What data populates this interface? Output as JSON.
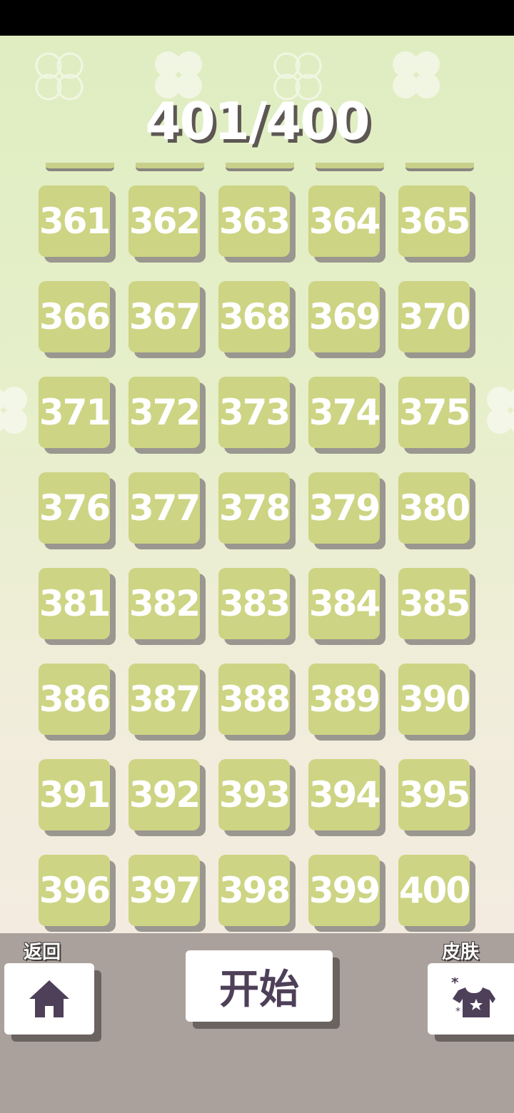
{
  "header": {
    "progress": "401/400"
  },
  "levels": [
    "361",
    "362",
    "363",
    "364",
    "365",
    "366",
    "367",
    "368",
    "369",
    "370",
    "371",
    "372",
    "373",
    "374",
    "375",
    "376",
    "377",
    "378",
    "379",
    "380",
    "381",
    "382",
    "383",
    "384",
    "385",
    "386",
    "387",
    "388",
    "389",
    "390",
    "391",
    "392",
    "393",
    "394",
    "395",
    "396",
    "397",
    "398",
    "399",
    "400"
  ],
  "toolbar": {
    "back_label": "返回",
    "start_label": "开始",
    "skin_label": "皮肤",
    "home_icon": "home-icon",
    "skin_icon": "tshirt-star-icon"
  },
  "colors": {
    "tile": "#cdd483",
    "tile_shadow": "#9a9690",
    "icon": "#4e4059",
    "bottom_bar": "#aaa19c"
  }
}
